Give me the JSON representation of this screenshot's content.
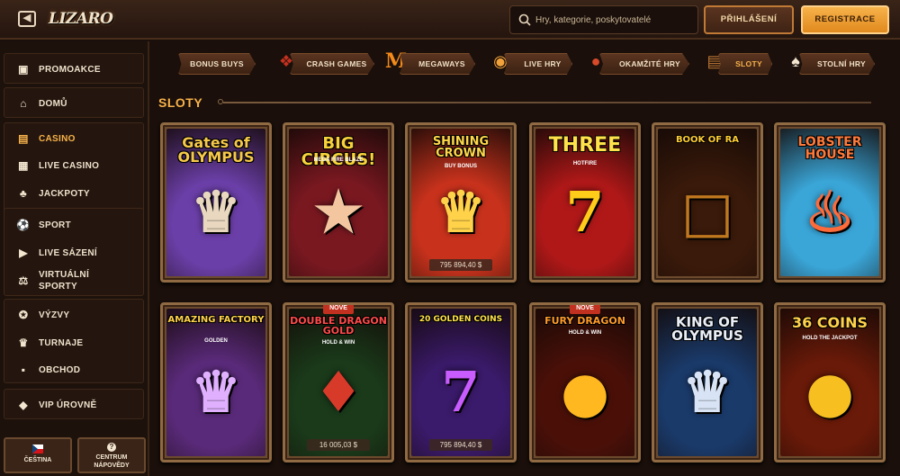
{
  "header": {
    "logo_text": "LIZARO",
    "search_placeholder": "Hry, kategorie, poskytovatelé",
    "login_label": "PŘIHLÁŠENÍ",
    "register_label": "REGISTRACE"
  },
  "sidebar": {
    "items": [
      {
        "label": "PROMOAKCE",
        "icon": "gift-icon"
      },
      {
        "label": "DOMŮ",
        "icon": "home-icon"
      },
      {
        "label": "CASINO",
        "icon": "casino-icon",
        "active": true
      },
      {
        "label": "LIVE CASINO",
        "icon": "cards-icon"
      },
      {
        "label": "JACKPOTY",
        "icon": "clover-icon"
      },
      {
        "label": "SPORT",
        "icon": "soccer-icon"
      },
      {
        "label": "LIVE SÁZENÍ",
        "icon": "live-play-icon"
      },
      {
        "label": "VIRTUÁLNÍ",
        "label2": "SPORTY",
        "icon": "virtual-sports-icon"
      },
      {
        "label": "VÝZVY",
        "icon": "medal-icon"
      },
      {
        "label": "TURNAJE",
        "icon": "trophy-icon"
      },
      {
        "label": "OBCHOD",
        "icon": "shop-bag-icon"
      },
      {
        "label": "VIP ÚROVNĚ",
        "icon": "diamond-icon"
      }
    ],
    "language_label": "ČEŠTINA",
    "help_label_1": "CENTRUM",
    "help_label_2": "NÁPOVĚDY"
  },
  "categories": [
    {
      "label": "BONUS BUYS"
    },
    {
      "label": "CRASH GAMES"
    },
    {
      "label": "MEGAWAYS"
    },
    {
      "label": "LIVE HRY"
    },
    {
      "label": "OKAMŽITÉ HRY"
    },
    {
      "label": "SLOTY"
    },
    {
      "label": "STOLNÍ HRY"
    }
  ],
  "section_title": "SLOTY",
  "games": [
    {
      "title": "Gates of OLYMPUS",
      "bg": "#6b3fa8",
      "badge": "",
      "jackpot": ""
    },
    {
      "title": "BIG CIRCUS!",
      "subtitle": "MEGA FIRE BLAZE",
      "bg": "#7a1820",
      "badge": "",
      "jackpot": ""
    },
    {
      "title": "SHINING CROWN",
      "subtitle": "BUY BONUS",
      "bg": "#c8321c",
      "badge": "",
      "jackpot": "795 894,40 $"
    },
    {
      "title": "THREE",
      "subtitle": "HOTFIRE",
      "bg": "#b01818",
      "badge": "",
      "jackpot": ""
    },
    {
      "title": "BOOK OF RA",
      "bg": "#3a1a0a",
      "badge": "",
      "jackpot": ""
    },
    {
      "title": "LOBSTER HOUSE",
      "bg": "#3aa6d8",
      "badge": "",
      "jackpot": ""
    },
    {
      "title": "AMAZING FACTORY",
      "subtitle": "GOLDEN",
      "bg": "#5a2a7a",
      "badge": "",
      "jackpot": ""
    },
    {
      "title": "DOUBLE DRAGON GOLD",
      "subtitle": "HOLD & WIN",
      "bg": "#1a3a1a",
      "badge": "NOVÉ",
      "jackpot": "16 005,03 $"
    },
    {
      "title": "20 GOLDEN COINS",
      "bg": "#3a1a6a",
      "badge": "",
      "jackpot": "795 894,40 $"
    },
    {
      "title": "FURY DRAGON",
      "subtitle": "HOLD & WIN",
      "bg": "#4a1008",
      "badge": "NOVÉ",
      "jackpot": ""
    },
    {
      "title": "KING OF OLYMPUS",
      "bg": "#1a3a6a",
      "badge": "",
      "jackpot": ""
    },
    {
      "title": "36 COINS",
      "subtitle": "HOLD THE JACKPOT",
      "bg": "#6a1a08",
      "badge": "",
      "jackpot": ""
    }
  ],
  "colors": {
    "accent": "#f7b24a",
    "bg": "#1a0f0a",
    "wood": "#8f6a42"
  }
}
